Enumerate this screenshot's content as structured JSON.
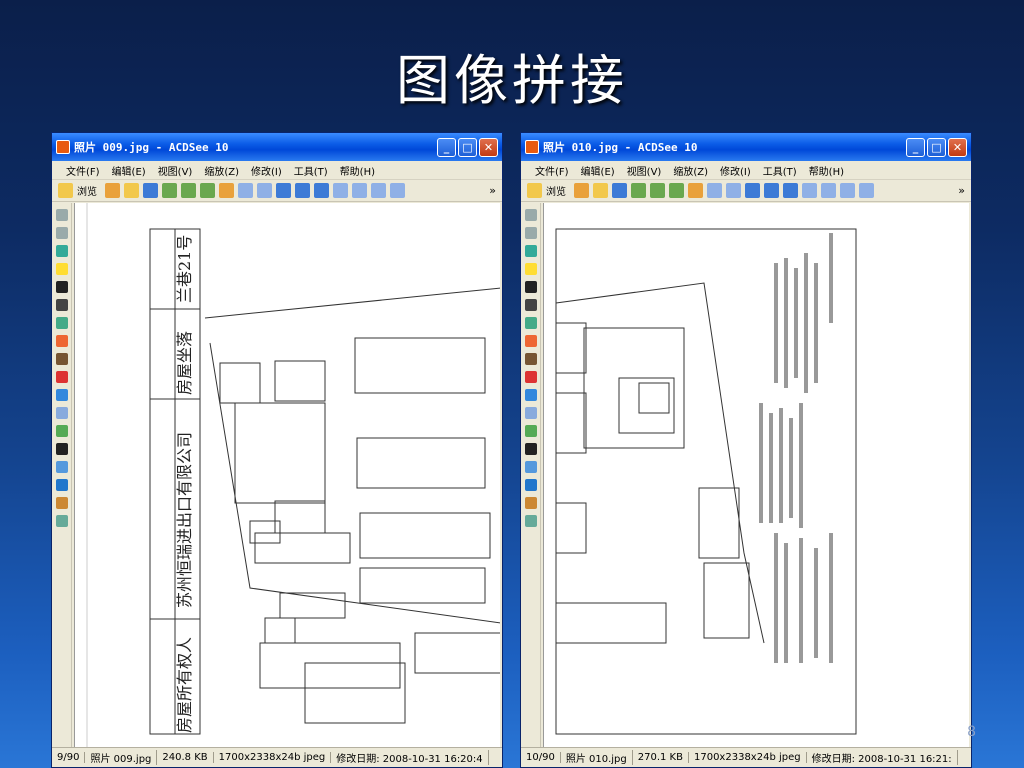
{
  "slide": {
    "title": "图像拼接",
    "page_number": "8"
  },
  "menu": [
    "文件(F)",
    "编辑(E)",
    "视图(V)",
    "缩放(Z)",
    "修改(I)",
    "工具(T)",
    "帮助(H)"
  ],
  "toolbar": {
    "browse_label": "浏览",
    "more": "»"
  },
  "windows": [
    {
      "title": "照片 009.jpg - ACDSee 10",
      "status": {
        "index": "9/90",
        "filename": "照片 009.jpg",
        "size": "240.8 KB",
        "dims": "1700x2338x24b jpeg",
        "modified": "修改日期: 2008-10-31 16:20:4"
      },
      "doc": {
        "owner_label": "房屋所有权人",
        "owner_value": "苏州恒瑞进出口有限公司",
        "location_label": "房屋坐落",
        "location_value": "兰巷21号"
      }
    },
    {
      "title": "照片 010.jpg - ACDSee 10",
      "status": {
        "index": "10/90",
        "filename": "照片 010.jpg",
        "size": "270.1 KB",
        "dims": "1700x2338x24b jpeg",
        "modified": "修改日期: 2008-10-31 16:21:"
      }
    }
  ],
  "colors": {
    "titlebar": "#0a5be6",
    "close": "#c23a12",
    "slide_bg": "#0d2b63"
  }
}
